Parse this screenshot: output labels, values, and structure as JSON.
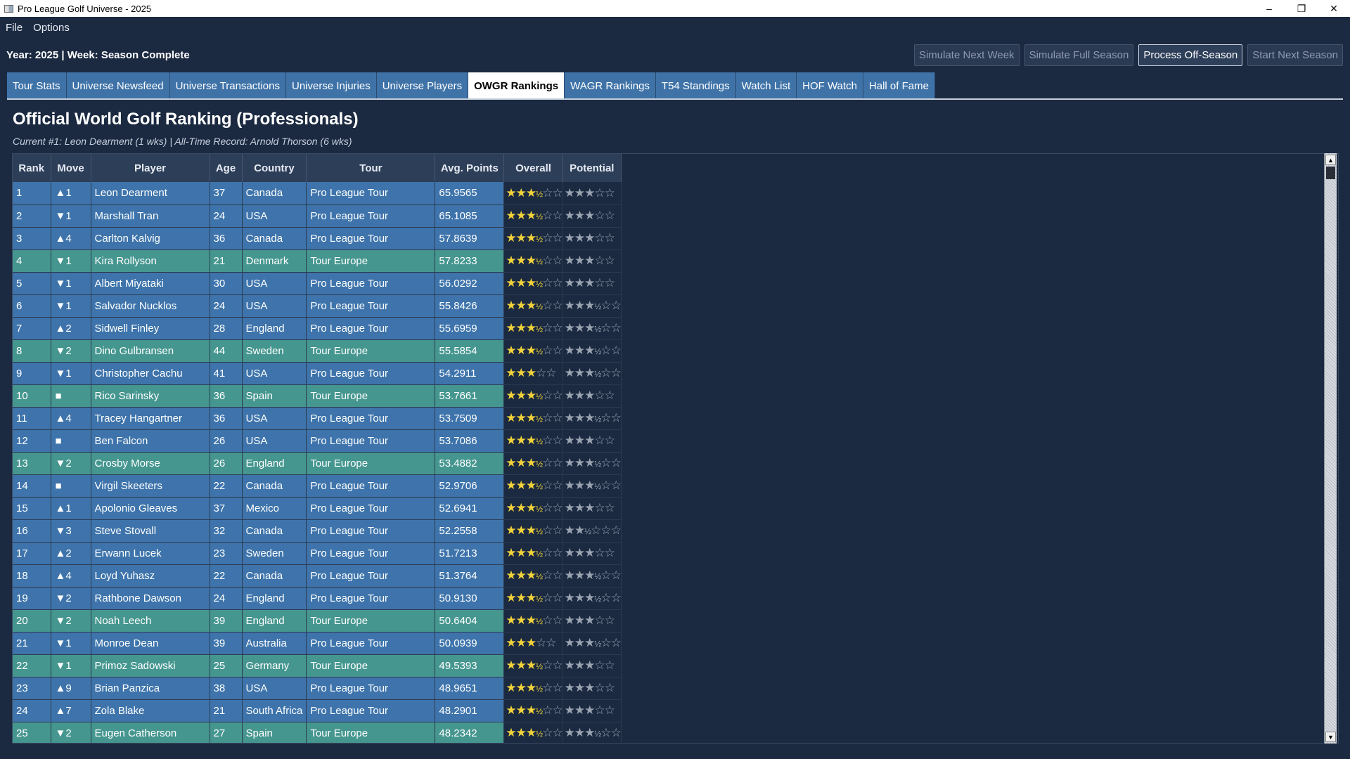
{
  "window": {
    "title": "Pro League Golf Universe - 2025",
    "minimize": "–",
    "restore": "❐",
    "close": "✕"
  },
  "menu": [
    "File",
    "Options"
  ],
  "status": "Year: 2025 | Week: Season Complete",
  "actions": [
    {
      "label": "Simulate Next Week",
      "active": false
    },
    {
      "label": "Simulate Full Season",
      "active": false
    },
    {
      "label": "Process Off-Season",
      "active": true
    },
    {
      "label": "Start Next Season",
      "active": false
    }
  ],
  "tabs": [
    {
      "label": "Tour Stats",
      "selected": false
    },
    {
      "label": "Universe Newsfeed",
      "selected": false
    },
    {
      "label": "Universe Transactions",
      "selected": false
    },
    {
      "label": "Universe Injuries",
      "selected": false
    },
    {
      "label": "Universe Players",
      "selected": false
    },
    {
      "label": "OWGR Rankings",
      "selected": true
    },
    {
      "label": "WAGR Rankings",
      "selected": false
    },
    {
      "label": "T54 Standings",
      "selected": false
    },
    {
      "label": "Watch List",
      "selected": false
    },
    {
      "label": "HOF Watch",
      "selected": false
    },
    {
      "label": "Hall of Fame",
      "selected": false
    }
  ],
  "heading": "Official World Golf Ranking (Professionals)",
  "subheading": "Current #1: Leon Dearment (1 wks)  |  All-Time Record: Arnold Thorson (6 wks)",
  "columns": [
    "Rank",
    "Move",
    "Player",
    "Age",
    "Country",
    "Tour",
    "Avg. Points",
    "Overall",
    "Potential"
  ],
  "colors": {
    "pro_league_row": "#3e74ab",
    "tour_europe_row": "#45968f",
    "star": "#f2d33b",
    "star_dim": "#9aa3b0"
  },
  "rows": [
    {
      "rank": "1",
      "move": "▲1",
      "player": "Leon Dearment",
      "age": "37",
      "country": "Canada",
      "tour": "Pro League Tour",
      "pts": "65.9565",
      "overall": 3.5,
      "potential": 3
    },
    {
      "rank": "2",
      "move": "▼1",
      "player": "Marshall Tran",
      "age": "24",
      "country": "USA",
      "tour": "Pro League Tour",
      "pts": "65.1085",
      "overall": 3.5,
      "potential": 3
    },
    {
      "rank": "3",
      "move": "▲4",
      "player": "Carlton Kalvig",
      "age": "36",
      "country": "Canada",
      "tour": "Pro League Tour",
      "pts": "57.8639",
      "overall": 3.5,
      "potential": 3
    },
    {
      "rank": "4",
      "move": "▼1",
      "player": "Kira Rollyson",
      "age": "21",
      "country": "Denmark",
      "tour": "Tour Europe",
      "pts": "57.8233",
      "overall": 3.5,
      "potential": 3
    },
    {
      "rank": "5",
      "move": "▼1",
      "player": "Albert Miyataki",
      "age": "30",
      "country": "USA",
      "tour": "Pro League Tour",
      "pts": "56.0292",
      "overall": 3.5,
      "potential": 3
    },
    {
      "rank": "6",
      "move": "▼1",
      "player": "Salvador Nucklos",
      "age": "24",
      "country": "USA",
      "tour": "Pro League Tour",
      "pts": "55.8426",
      "overall": 3.5,
      "potential": 3.5
    },
    {
      "rank": "7",
      "move": "▲2",
      "player": "Sidwell Finley",
      "age": "28",
      "country": "England",
      "tour": "Pro League Tour",
      "pts": "55.6959",
      "overall": 3.5,
      "potential": 3.5
    },
    {
      "rank": "8",
      "move": "▼2",
      "player": "Dino Gulbransen",
      "age": "44",
      "country": "Sweden",
      "tour": "Tour Europe",
      "pts": "55.5854",
      "overall": 3.5,
      "potential": 3.5
    },
    {
      "rank": "9",
      "move": "▼1",
      "player": "Christopher Cachu",
      "age": "41",
      "country": "USA",
      "tour": "Pro League Tour",
      "pts": "54.2911",
      "overall": 3,
      "potential": 3.5
    },
    {
      "rank": "10",
      "move": "■",
      "player": "Rico Sarinsky",
      "age": "36",
      "country": "Spain",
      "tour": "Tour Europe",
      "pts": "53.7661",
      "overall": 3.5,
      "potential": 3
    },
    {
      "rank": "11",
      "move": "▲4",
      "player": "Tracey Hangartner",
      "age": "36",
      "country": "USA",
      "tour": "Pro League Tour",
      "pts": "53.7509",
      "overall": 3.5,
      "potential": 3.5
    },
    {
      "rank": "12",
      "move": "■",
      "player": "Ben Falcon",
      "age": "26",
      "country": "USA",
      "tour": "Pro League Tour",
      "pts": "53.7086",
      "overall": 3.5,
      "potential": 3
    },
    {
      "rank": "13",
      "move": "▼2",
      "player": "Crosby Morse",
      "age": "26",
      "country": "England",
      "tour": "Tour Europe",
      "pts": "53.4882",
      "overall": 3.5,
      "potential": 3.5
    },
    {
      "rank": "14",
      "move": "■",
      "player": "Virgil Skeeters",
      "age": "22",
      "country": "Canada",
      "tour": "Pro League Tour",
      "pts": "52.9706",
      "overall": 3.5,
      "potential": 3.5
    },
    {
      "rank": "15",
      "move": "▲1",
      "player": "Apolonio Gleaves",
      "age": "37",
      "country": "Mexico",
      "tour": "Pro League Tour",
      "pts": "52.6941",
      "overall": 3.5,
      "potential": 3
    },
    {
      "rank": "16",
      "move": "▼3",
      "player": "Steve Stovall",
      "age": "32",
      "country": "Canada",
      "tour": "Pro League Tour",
      "pts": "52.2558",
      "overall": 3.5,
      "potential": 2.5
    },
    {
      "rank": "17",
      "move": "▲2",
      "player": "Erwann Lucek",
      "age": "23",
      "country": "Sweden",
      "tour": "Pro League Tour",
      "pts": "51.7213",
      "overall": 3.5,
      "potential": 3
    },
    {
      "rank": "18",
      "move": "▲4",
      "player": "Loyd Yuhasz",
      "age": "22",
      "country": "Canada",
      "tour": "Pro League Tour",
      "pts": "51.3764",
      "overall": 3.5,
      "potential": 3.5
    },
    {
      "rank": "19",
      "move": "▼2",
      "player": "Rathbone Dawson",
      "age": "24",
      "country": "England",
      "tour": "Pro League Tour",
      "pts": "50.9130",
      "overall": 3.5,
      "potential": 3.5
    },
    {
      "rank": "20",
      "move": "▼2",
      "player": "Noah Leech",
      "age": "39",
      "country": "England",
      "tour": "Tour Europe",
      "pts": "50.6404",
      "overall": 3.5,
      "potential": 3
    },
    {
      "rank": "21",
      "move": "▼1",
      "player": "Monroe Dean",
      "age": "39",
      "country": "Australia",
      "tour": "Pro League Tour",
      "pts": "50.0939",
      "overall": 3,
      "potential": 3.5
    },
    {
      "rank": "22",
      "move": "▼1",
      "player": "Primoz Sadowski",
      "age": "25",
      "country": "Germany",
      "tour": "Tour Europe",
      "pts": "49.5393",
      "overall": 3.5,
      "potential": 3
    },
    {
      "rank": "23",
      "move": "▲9",
      "player": "Brian Panzica",
      "age": "38",
      "country": "USA",
      "tour": "Pro League Tour",
      "pts": "48.9651",
      "overall": 3.5,
      "potential": 3
    },
    {
      "rank": "24",
      "move": "▲7",
      "player": "Zola Blake",
      "age": "21",
      "country": "South Africa",
      "tour": "Pro League Tour",
      "pts": "48.2901",
      "overall": 3.5,
      "potential": 3
    },
    {
      "rank": "25",
      "move": "▼2",
      "player": "Eugen Catherson",
      "age": "27",
      "country": "Spain",
      "tour": "Tour Europe",
      "pts": "48.2342",
      "overall": 3.5,
      "potential": 3.5
    }
  ]
}
